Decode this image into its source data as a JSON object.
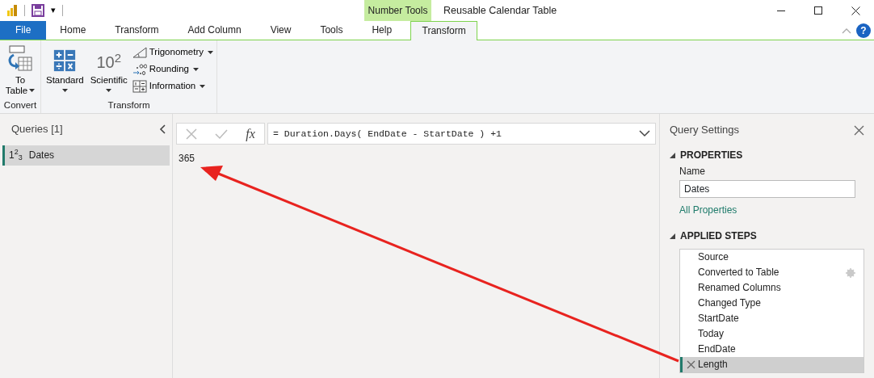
{
  "window": {
    "title": "Reusable Calendar Table",
    "quick_access_more": "▾"
  },
  "contextual_group": {
    "label": "Number Tools"
  },
  "tabs": [
    {
      "label": "File",
      "kind": "file",
      "selected": false
    },
    {
      "label": "Home",
      "kind": "tab",
      "selected": false
    },
    {
      "label": "Transform",
      "kind": "tab",
      "selected": false
    },
    {
      "label": "Add Column",
      "kind": "tab",
      "selected": false
    },
    {
      "label": "View",
      "kind": "tab",
      "selected": false
    },
    {
      "label": "Tools",
      "kind": "tab",
      "selected": false
    },
    {
      "label": "Help",
      "kind": "tab",
      "selected": false
    },
    {
      "label": "Transform",
      "kind": "contextual",
      "selected": true
    }
  ],
  "help": "?",
  "ribbon_groups": [
    {
      "label": "Convert",
      "buttons": [
        {
          "label": "To Table",
          "kind": "large",
          "dropdown": true
        }
      ]
    },
    {
      "label": "Transform",
      "buttons": [
        {
          "label": "Standard",
          "kind": "large",
          "dropdown": true
        },
        {
          "label": "Scientific",
          "kind": "large",
          "dropdown": true
        },
        {
          "label": "Trigonometry",
          "kind": "small",
          "dropdown": true
        },
        {
          "label": "Rounding",
          "kind": "small",
          "dropdown": true
        },
        {
          "label": "Information",
          "kind": "small",
          "dropdown": true
        }
      ]
    }
  ],
  "scientific_label": "10$^{2}$",
  "queries": {
    "title": "Queries [1]",
    "items": [
      {
        "type_label": "1$^{2}$$_{3}$",
        "name": "Dates",
        "selected": true
      }
    ]
  },
  "formula_bar": {
    "fx_label": "fx",
    "formula": "= Duration.Days( EndDate - StartDate ) +1"
  },
  "result": "365",
  "query_settings": {
    "title": "Query Settings",
    "properties_heading": "PROPERTIES",
    "name_label": "Name",
    "name_value": "Dates",
    "all_properties": "All Properties",
    "steps_heading": "APPLIED STEPS",
    "steps": [
      {
        "label": "Source",
        "settings": false,
        "selected": false
      },
      {
        "label": "Converted to Table",
        "settings": true,
        "selected": false
      },
      {
        "label": "Renamed Columns",
        "settings": false,
        "selected": false
      },
      {
        "label": "Changed Type",
        "settings": false,
        "selected": false
      },
      {
        "label": "StartDate",
        "settings": false,
        "selected": false
      },
      {
        "label": "Today",
        "settings": false,
        "selected": false
      },
      {
        "label": "EndDate",
        "settings": false,
        "selected": false
      },
      {
        "label": "Length",
        "settings": false,
        "selected": true
      }
    ]
  }
}
